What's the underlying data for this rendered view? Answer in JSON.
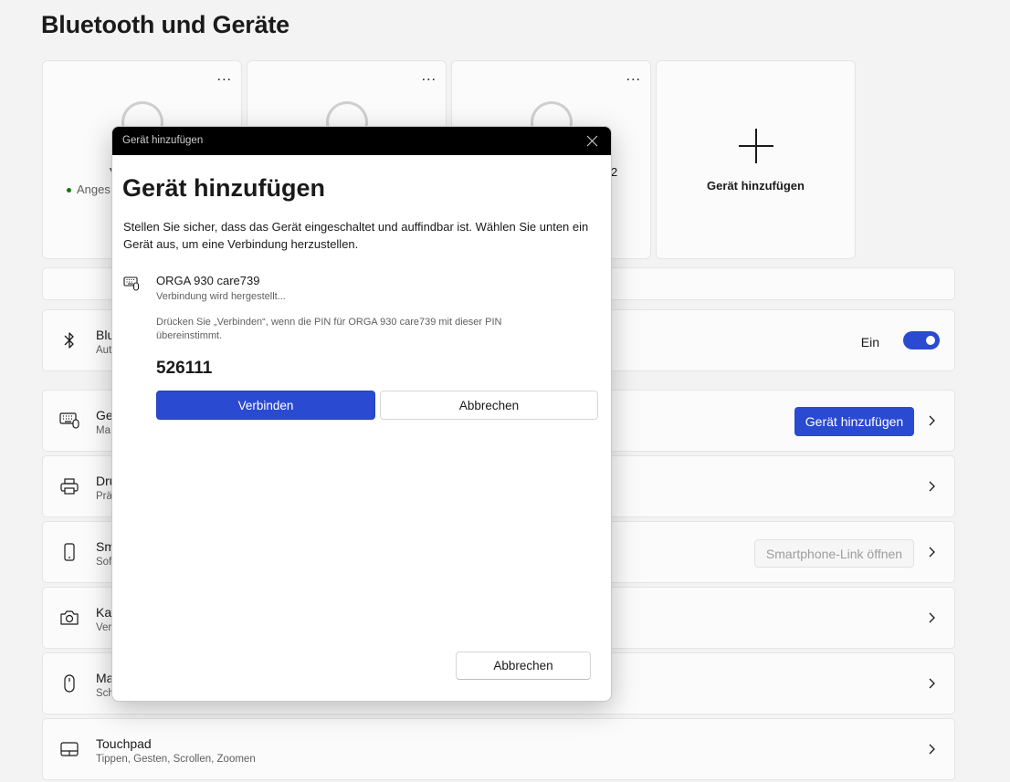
{
  "page": {
    "title": "Bluetooth und Geräte"
  },
  "cards": [
    {
      "partial_name": "V",
      "status": "Anges",
      "more": "..."
    },
    {
      "more": "..."
    },
    {
      "partial_name": "2",
      "more": "..."
    }
  ],
  "add_card": {
    "label": "Gerät hinzufügen"
  },
  "rows": {
    "bluetooth": {
      "title": "Blu",
      "subtitle": "Aut",
      "toggle_label": "Ein",
      "toggle_on": true
    },
    "devices": {
      "title": "Ge",
      "subtitle": "Ma",
      "button": "Gerät hinzufügen"
    },
    "printers": {
      "title": "Dru",
      "subtitle": "Prä"
    },
    "smartphone": {
      "title": "Sm",
      "subtitle": "Sof",
      "button": "Smartphone-Link öffnen"
    },
    "camera": {
      "title": "Ka",
      "subtitle": "Ver"
    },
    "mouse": {
      "title": "Ma",
      "subtitle": "Sch"
    },
    "touchpad": {
      "title": "Touchpad",
      "subtitle": "Tippen, Gesten, Scrollen, Zoomen"
    }
  },
  "dialog": {
    "window_title": "Gerät hinzufügen",
    "heading": "Gerät hinzufügen",
    "description": "Stellen Sie sicher, dass das Gerät eingeschaltet und auffindbar ist. Wählen Sie unten ein Gerät aus, um eine Verbindung herzustellen.",
    "device_name": "ORGA 930 care739",
    "device_state": "Verbindung wird hergestellt...",
    "pin_note": "Drücken Sie „Verbinden“, wenn die PIN für ORGA 930 care739 mit dieser PIN übereinstimmt.",
    "pin": "526111",
    "connect_label": "Verbinden",
    "cancel_label": "Abbrechen",
    "footer_cancel_label": "Abbrechen"
  },
  "colors": {
    "accent": "#2a4ad1",
    "background": "#f3f3f3",
    "card": "#fbfbfb",
    "status_green": "#0f7b0f"
  }
}
